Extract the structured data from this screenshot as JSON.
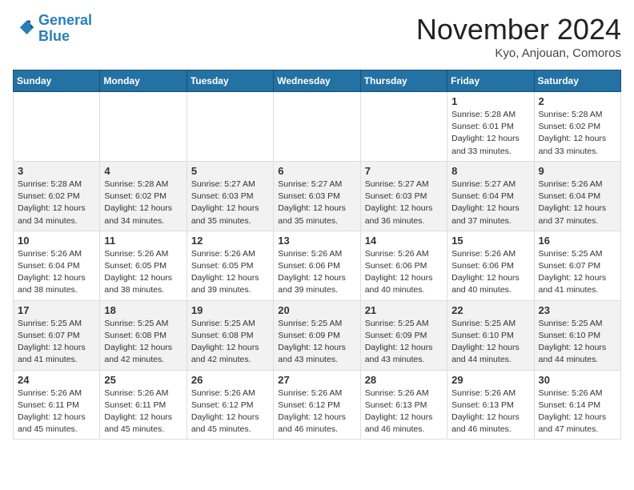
{
  "logo": {
    "line1": "General",
    "line2": "Blue"
  },
  "title": "November 2024",
  "location": "Kyo, Anjouan, Comoros",
  "weekdays": [
    "Sunday",
    "Monday",
    "Tuesday",
    "Wednesday",
    "Thursday",
    "Friday",
    "Saturday"
  ],
  "weeks": [
    [
      {
        "day": "",
        "info": ""
      },
      {
        "day": "",
        "info": ""
      },
      {
        "day": "",
        "info": ""
      },
      {
        "day": "",
        "info": ""
      },
      {
        "day": "",
        "info": ""
      },
      {
        "day": "1",
        "info": "Sunrise: 5:28 AM\nSunset: 6:01 PM\nDaylight: 12 hours and 33 minutes."
      },
      {
        "day": "2",
        "info": "Sunrise: 5:28 AM\nSunset: 6:02 PM\nDaylight: 12 hours and 33 minutes."
      }
    ],
    [
      {
        "day": "3",
        "info": "Sunrise: 5:28 AM\nSunset: 6:02 PM\nDaylight: 12 hours and 34 minutes."
      },
      {
        "day": "4",
        "info": "Sunrise: 5:28 AM\nSunset: 6:02 PM\nDaylight: 12 hours and 34 minutes."
      },
      {
        "day": "5",
        "info": "Sunrise: 5:27 AM\nSunset: 6:03 PM\nDaylight: 12 hours and 35 minutes."
      },
      {
        "day": "6",
        "info": "Sunrise: 5:27 AM\nSunset: 6:03 PM\nDaylight: 12 hours and 35 minutes."
      },
      {
        "day": "7",
        "info": "Sunrise: 5:27 AM\nSunset: 6:03 PM\nDaylight: 12 hours and 36 minutes."
      },
      {
        "day": "8",
        "info": "Sunrise: 5:27 AM\nSunset: 6:04 PM\nDaylight: 12 hours and 37 minutes."
      },
      {
        "day": "9",
        "info": "Sunrise: 5:26 AM\nSunset: 6:04 PM\nDaylight: 12 hours and 37 minutes."
      }
    ],
    [
      {
        "day": "10",
        "info": "Sunrise: 5:26 AM\nSunset: 6:04 PM\nDaylight: 12 hours and 38 minutes."
      },
      {
        "day": "11",
        "info": "Sunrise: 5:26 AM\nSunset: 6:05 PM\nDaylight: 12 hours and 38 minutes."
      },
      {
        "day": "12",
        "info": "Sunrise: 5:26 AM\nSunset: 6:05 PM\nDaylight: 12 hours and 39 minutes."
      },
      {
        "day": "13",
        "info": "Sunrise: 5:26 AM\nSunset: 6:06 PM\nDaylight: 12 hours and 39 minutes."
      },
      {
        "day": "14",
        "info": "Sunrise: 5:26 AM\nSunset: 6:06 PM\nDaylight: 12 hours and 40 minutes."
      },
      {
        "day": "15",
        "info": "Sunrise: 5:26 AM\nSunset: 6:06 PM\nDaylight: 12 hours and 40 minutes."
      },
      {
        "day": "16",
        "info": "Sunrise: 5:25 AM\nSunset: 6:07 PM\nDaylight: 12 hours and 41 minutes."
      }
    ],
    [
      {
        "day": "17",
        "info": "Sunrise: 5:25 AM\nSunset: 6:07 PM\nDaylight: 12 hours and 41 minutes."
      },
      {
        "day": "18",
        "info": "Sunrise: 5:25 AM\nSunset: 6:08 PM\nDaylight: 12 hours and 42 minutes."
      },
      {
        "day": "19",
        "info": "Sunrise: 5:25 AM\nSunset: 6:08 PM\nDaylight: 12 hours and 42 minutes."
      },
      {
        "day": "20",
        "info": "Sunrise: 5:25 AM\nSunset: 6:09 PM\nDaylight: 12 hours and 43 minutes."
      },
      {
        "day": "21",
        "info": "Sunrise: 5:25 AM\nSunset: 6:09 PM\nDaylight: 12 hours and 43 minutes."
      },
      {
        "day": "22",
        "info": "Sunrise: 5:25 AM\nSunset: 6:10 PM\nDaylight: 12 hours and 44 minutes."
      },
      {
        "day": "23",
        "info": "Sunrise: 5:25 AM\nSunset: 6:10 PM\nDaylight: 12 hours and 44 minutes."
      }
    ],
    [
      {
        "day": "24",
        "info": "Sunrise: 5:26 AM\nSunset: 6:11 PM\nDaylight: 12 hours and 45 minutes."
      },
      {
        "day": "25",
        "info": "Sunrise: 5:26 AM\nSunset: 6:11 PM\nDaylight: 12 hours and 45 minutes."
      },
      {
        "day": "26",
        "info": "Sunrise: 5:26 AM\nSunset: 6:12 PM\nDaylight: 12 hours and 45 minutes."
      },
      {
        "day": "27",
        "info": "Sunrise: 5:26 AM\nSunset: 6:12 PM\nDaylight: 12 hours and 46 minutes."
      },
      {
        "day": "28",
        "info": "Sunrise: 5:26 AM\nSunset: 6:13 PM\nDaylight: 12 hours and 46 minutes."
      },
      {
        "day": "29",
        "info": "Sunrise: 5:26 AM\nSunset: 6:13 PM\nDaylight: 12 hours and 46 minutes."
      },
      {
        "day": "30",
        "info": "Sunrise: 5:26 AM\nSunset: 6:14 PM\nDaylight: 12 hours and 47 minutes."
      }
    ]
  ]
}
